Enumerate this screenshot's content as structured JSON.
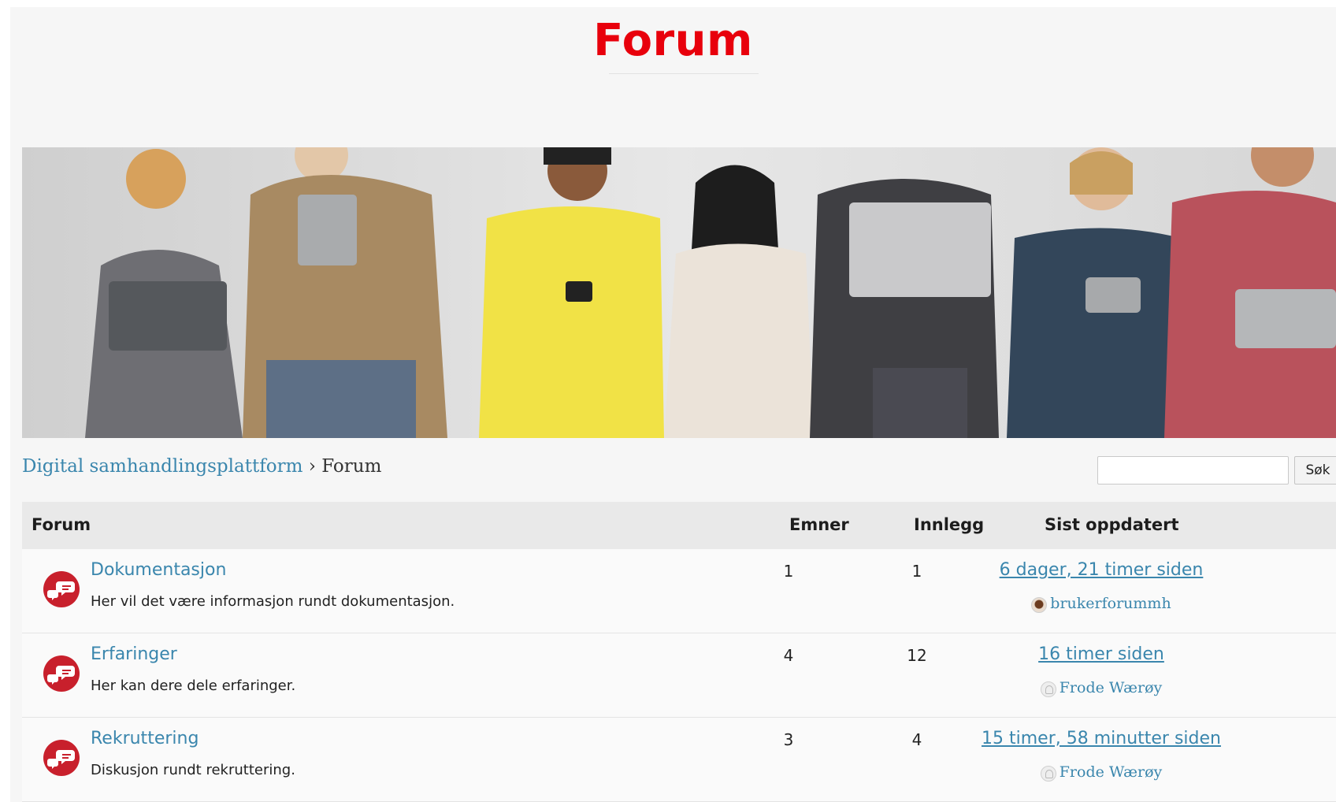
{
  "page": {
    "title": "Forum",
    "title_color": "#e8000c",
    "accent_color": "#3a86ad"
  },
  "hero": {
    "image": "people-with-devices-banner"
  },
  "breadcrumb": {
    "home_label": "Digital samhandlingsplattform",
    "separator": "›",
    "current": "Forum"
  },
  "search": {
    "value": "",
    "button_label": "Søk"
  },
  "table": {
    "headers": {
      "forum": "Forum",
      "topics": "Emner",
      "posts": "Innlegg",
      "last_updated": "Sist oppdatert"
    },
    "rows": [
      {
        "name": "Dokumentasjon",
        "description": "Her vil det være informasjon rundt dokumentasjon.",
        "topics": "1",
        "posts": "1",
        "last_updated": "6 dager, 21 timer siden",
        "last_author": "brukerforummh",
        "avatar": "photo"
      },
      {
        "name": "Erfaringer",
        "description": "Her kan dere dele erfaringer.",
        "topics": "4",
        "posts": "12",
        "last_updated": "16 timer siden",
        "last_author": "Frode Wærøy",
        "avatar": "default"
      },
      {
        "name": "Rekruttering",
        "description": "Diskusjon rundt rekruttering.",
        "topics": "3",
        "posts": "4",
        "last_updated": "15 timer, 58 minutter siden",
        "last_author": "Frode Wærøy",
        "avatar": "default"
      }
    ]
  }
}
